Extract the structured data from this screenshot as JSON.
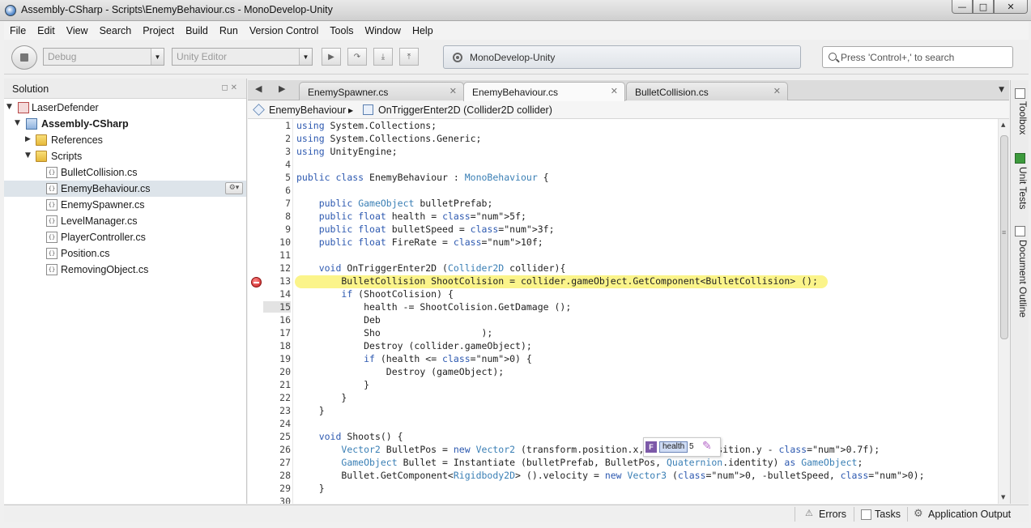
{
  "window": {
    "title": "Assembly-CSharp - Scripts\\EnemyBehaviour.cs - MonoDevelop-Unity",
    "controls": {
      "minimize": "—",
      "maximize": "□",
      "close": "✕"
    }
  },
  "menu": [
    "File",
    "Edit",
    "View",
    "Search",
    "Project",
    "Build",
    "Run",
    "Version Control",
    "Tools",
    "Window",
    "Help"
  ],
  "toolbar": {
    "config": "Debug",
    "target": "Unity Editor",
    "debug_buttons": [
      "▶",
      "↷",
      "⤓",
      "⤒"
    ],
    "status_text": "MonoDevelop-Unity",
    "search_placeholder": "Press 'Control+,' to search"
  },
  "solution": {
    "title": "Solution",
    "header_buttons": "◻✕",
    "tree": [
      {
        "label": "LaserDefender",
        "kind": "solution",
        "expander": "▼"
      },
      {
        "label": "Assembly-CSharp",
        "kind": "project",
        "expander": "▼"
      },
      {
        "label": "References",
        "kind": "folder",
        "expander": "▶"
      },
      {
        "label": "Scripts",
        "kind": "folder",
        "expander": "▼"
      },
      {
        "label": "BulletCollision.cs",
        "kind": "file"
      },
      {
        "label": "EnemyBehaviour.cs",
        "kind": "file",
        "selected": true
      },
      {
        "label": "EnemySpawner.cs",
        "kind": "file"
      },
      {
        "label": "LevelManager.cs",
        "kind": "file"
      },
      {
        "label": "PlayerController.cs",
        "kind": "file"
      },
      {
        "label": "Position.cs",
        "kind": "file"
      },
      {
        "label": "RemovingObject.cs",
        "kind": "file"
      }
    ],
    "file_glyph": "{}",
    "gear_glyph": "⚙▾"
  },
  "tabs": [
    {
      "label": "EnemySpawner.cs",
      "active": false
    },
    {
      "label": "EnemyBehaviour.cs",
      "active": true
    },
    {
      "label": "BulletCollision.cs",
      "active": false
    }
  ],
  "tab_close_glyph": "✕",
  "tab_nav": {
    "back": "◀",
    "forward": "▶",
    "dropdown": "▼"
  },
  "path": {
    "class": "EnemyBehaviour",
    "separator": "▶",
    "member": "OnTriggerEnter2D (Collider2D collider)"
  },
  "code": {
    "current_line": 15,
    "breakpoint_line": 13,
    "lines": [
      "using System.Collections;",
      "using System.Collections.Generic;",
      "using UnityEngine;",
      "",
      "public class EnemyBehaviour : MonoBehaviour {",
      "",
      "    public GameObject bulletPrefab;",
      "    public float health = 5f;",
      "    public float bulletSpeed = 3f;",
      "    public float FireRate = 10f;",
      "",
      "    void OnTriggerEnter2D (Collider2D collider){",
      "        BulletCollision ShootColision = collider.gameObject.GetComponent<BulletCollision> ();",
      "        if (ShootColision) {",
      "            health -= ShootColision.GetDamage ();",
      "            Deb",
      "            Sho                  );",
      "            Destroy (collider.gameObject);",
      "            if (health <= 0) {",
      "                Destroy (gameObject);",
      "            }",
      "        }",
      "    }",
      "",
      "    void Shoots() {",
      "        Vector2 BulletPos = new Vector2 (transform.position.x, transform.position.y - 0.7f);",
      "        GameObject Bullet = Instantiate (bulletPrefab, BulletPos, Quaternion.identity) as GameObject;",
      "        Bullet.GetComponent<Rigidbody2D> ().velocity = new Vector3 (0, -bulletSpeed, 0);",
      "    }",
      ""
    ]
  },
  "tooltip": {
    "badge": "F",
    "name": "health",
    "value": "5",
    "pin_glyph": "✎"
  },
  "right_dock": [
    "Toolbox",
    "Unit Tests",
    "Document Outline"
  ],
  "statusbar": {
    "errors": "Errors",
    "tasks": "Tasks",
    "output": "Application Output"
  }
}
